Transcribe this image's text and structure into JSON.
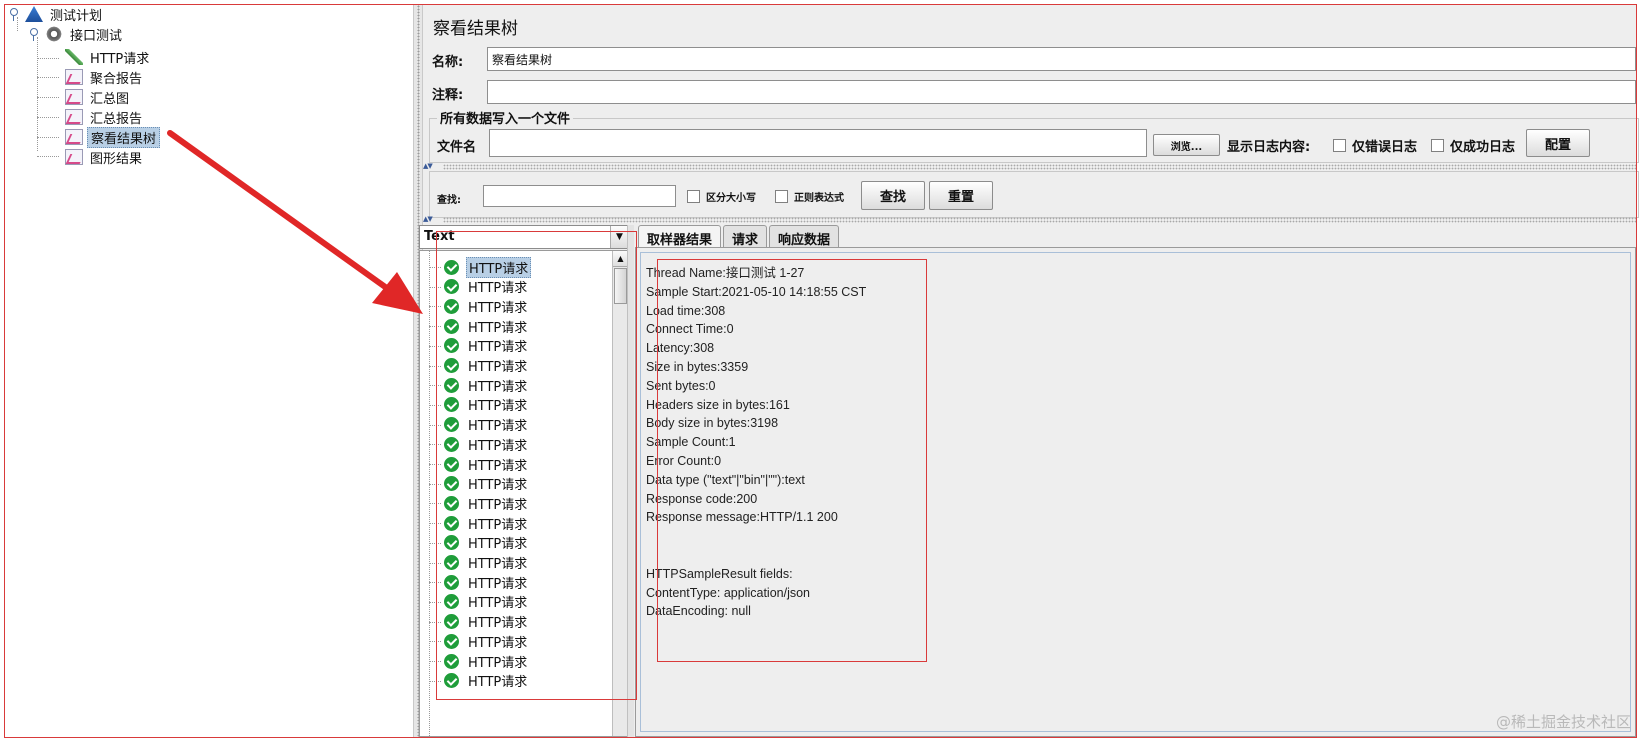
{
  "tree": {
    "items": [
      {
        "label": "测试计划"
      },
      {
        "label": "接口测试"
      },
      {
        "label": "HTTP请求"
      },
      {
        "label": "聚合报告"
      },
      {
        "label": "汇总图"
      },
      {
        "label": "汇总报告"
      },
      {
        "label": "察看结果树"
      },
      {
        "label": "图形结果"
      }
    ]
  },
  "panel": {
    "title": "察看结果树",
    "name_label": "名称:",
    "name_value": "察看结果树",
    "comment_label": "注释:",
    "comment_value": "",
    "file_group_title": "所有数据写入一个文件",
    "filename_label": "文件名",
    "filename_value": "",
    "browse_button": "浏览...",
    "log_content_label": "显示日志内容:",
    "errors_only_label": "仅错误日志",
    "success_only_label": "仅成功日志",
    "configure_button": "配置"
  },
  "search": {
    "label": "查找:",
    "value": "",
    "case_sensitive_label": "区分大小写",
    "regex_label": "正则表达式",
    "find_button": "查找",
    "reset_button": "重置"
  },
  "results": {
    "renderer": "Text",
    "items": [
      "HTTP请求",
      "HTTP请求",
      "HTTP请求",
      "HTTP请求",
      "HTTP请求",
      "HTTP请求",
      "HTTP请求",
      "HTTP请求",
      "HTTP请求",
      "HTTP请求",
      "HTTP请求",
      "HTTP请求",
      "HTTP请求",
      "HTTP请求",
      "HTTP请求",
      "HTTP请求",
      "HTTP请求",
      "HTTP请求",
      "HTTP请求",
      "HTTP请求",
      "HTTP请求",
      "HTTP请求"
    ]
  },
  "tabs": [
    {
      "label": "取样器结果",
      "active": true
    },
    {
      "label": "请求",
      "active": false
    },
    {
      "label": "响应数据",
      "active": false
    }
  ],
  "sampler_result": {
    "lines": [
      "Thread Name:接口测试 1-27",
      "Sample Start:2021-05-10 14:18:55 CST",
      "Load time:308",
      "Connect Time:0",
      "Latency:308",
      "Size in bytes:3359",
      "Sent bytes:0",
      "Headers size in bytes:161",
      "Body size in bytes:3198",
      "Sample Count:1",
      "Error Count:0",
      "Data type (\"text\"|\"bin\"|\"\"):text",
      "Response code:200",
      "Response message:HTTP/1.1 200",
      "",
      "",
      "HTTPSampleResult fields:",
      "ContentType: application/json",
      "DataEncoding: null"
    ]
  },
  "watermark": "@稀土掘金技术社区",
  "colors": {
    "annotation_red": "#d93a3a",
    "selection_blue": "#b8cfe5",
    "success_green": "#1f9d3a"
  },
  "icons": {
    "test_plan": "flask-icon",
    "thread_group": "gear-icon",
    "http_sampler": "pipette-icon",
    "listener": "chart-icon",
    "result_ok": "green-shield-check-icon"
  }
}
